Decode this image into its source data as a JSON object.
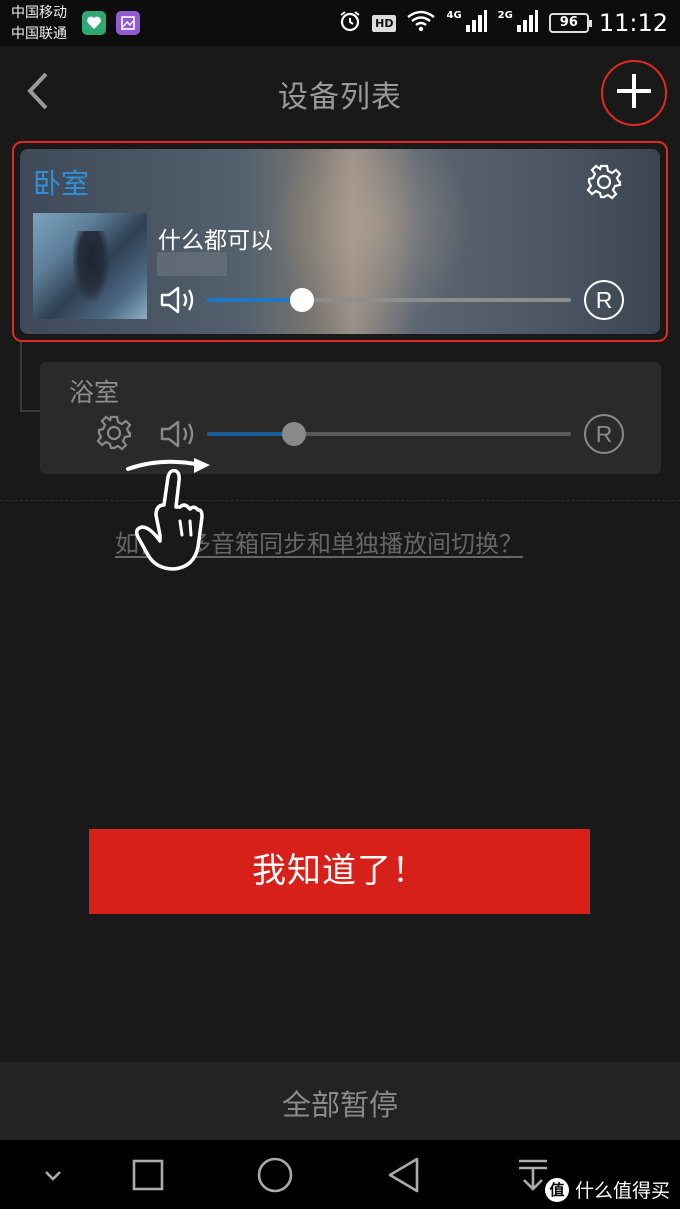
{
  "status_bar": {
    "carrier1": "中国移动",
    "carrier2": "中国联通",
    "hd": "HD",
    "net1": "4G",
    "net2": "2G",
    "battery": "96",
    "time": "11:12",
    "icons": [
      "health-app-icon",
      "gallery-app-icon",
      "alarm-icon",
      "wifi-icon",
      "signal-icon",
      "battery-icon"
    ]
  },
  "header": {
    "title": "设备列表",
    "back_icon": "chevron-left-icon",
    "add_icon": "plus-icon"
  },
  "devices": [
    {
      "room": "卧室",
      "song": "什么都可以",
      "volume": 0.26,
      "repeat_label": "R",
      "settings_icon": "gear-icon",
      "volume_icon": "speaker-icon",
      "accent": "#2f8fd8"
    },
    {
      "room": "浴室",
      "volume": 0.24,
      "repeat_label": "R",
      "settings_icon": "gear-icon",
      "volume_icon": "speaker-icon"
    }
  ],
  "help_link": "如何在多音箱同步和单独播放间切换？",
  "ok_button": "我知道了！",
  "pause_all": "全部暂停",
  "nav": [
    "chevron-down-icon",
    "square-icon",
    "circle-icon",
    "triangle-back-icon",
    "download-icon"
  ],
  "watermark": {
    "badge": "值",
    "text": "什么值得买"
  },
  "colors": {
    "highlight": "#e02a23",
    "button": "#d7201a",
    "slider_fill": "#1f78c7"
  }
}
